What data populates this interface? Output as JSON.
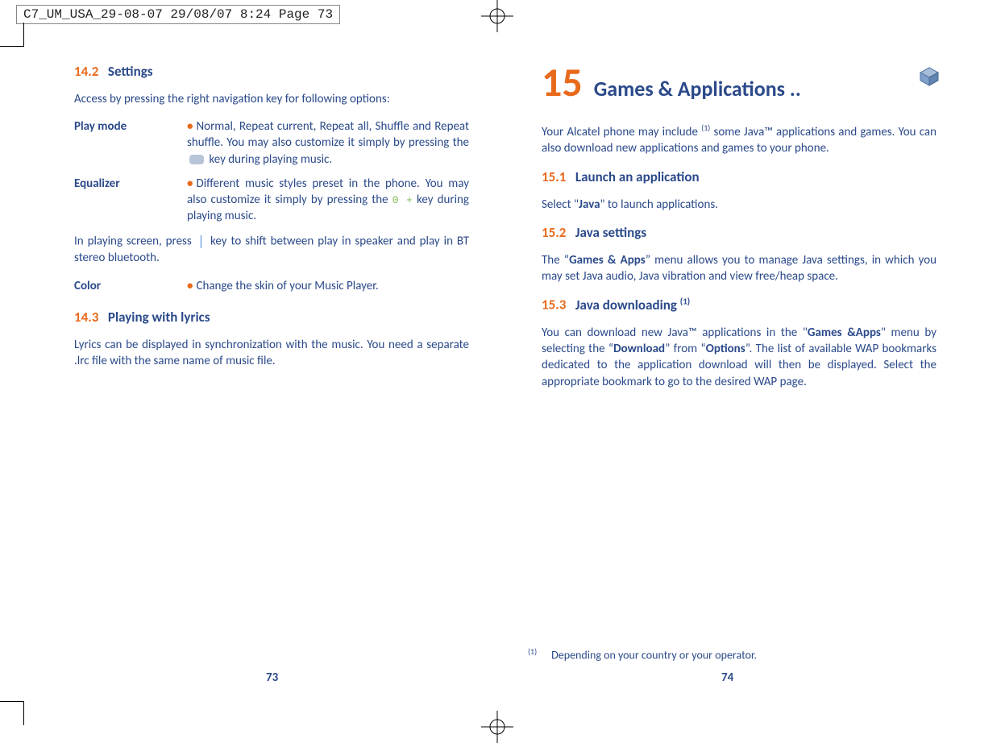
{
  "header": "C7_UM_USA_29-08-07  29/08/07  8:24  Page 73",
  "left": {
    "s142_num": "14.2",
    "s142_title": "Settings",
    "s142_intro": "Access by pressing the right navigation key for following options:",
    "playmode_term": "Play mode",
    "playmode_def_a": "Normal, Repeat current, Repeat all, Shuffle and Repeat shuffle. You may also customize it simply by pressing the ",
    "playmode_def_b": " key during playing music.",
    "eq_term": "Equalizer",
    "eq_def_a": "Different music styles preset in the phone. You may also customize it simply by pressing the ",
    "eq_zerokey": "0 +",
    "eq_def_b": " key during playing music.",
    "bt_a": "In playing screen, press ",
    "bt_icon": "❘",
    "bt_b": " key to shift between play in speaker and play in BT stereo bluetooth.",
    "color_term": "Color",
    "color_def": "Change the skin of your Music Player.",
    "s143_num": "14.3",
    "s143_title": "Playing with lyrics",
    "s143_body": "Lyrics can be displayed in synchronization with the music. You need a separate .lrc file with the same name of music file.",
    "pagenum": "73"
  },
  "right": {
    "chapnum": "15",
    "chaptitle": "Games & Applications ..",
    "intro_a": "Your Alcatel phone may include ",
    "intro_sup": "(1)",
    "intro_b": " some Java™ applications and games. You can also download new applications and games to your phone.",
    "s151_num": "15.1",
    "s151_title": "Launch an application",
    "s151_body_a": "Select \"",
    "s151_java": "Java",
    "s151_body_b": "\" to launch applications.",
    "s152_num": "15.2",
    "s152_title": "Java settings",
    "s152_body_a": "The “",
    "s152_ga": "Games & Apps",
    "s152_body_b": "” menu allows you to manage Java settings, in which you may set Java audio, Java vibration and view free/heap space.",
    "s153_num": "15.3",
    "s153_title_a": "Java downloading ",
    "s153_sup": "(1)",
    "s153_body_a": "You can download new Java™ applications in the \"",
    "s153_ga": "Games &Apps",
    "s153_body_b": "\" menu by selecting the “",
    "s153_dl": "Download",
    "s153_body_c": "” from “",
    "s153_opt": "Options",
    "s153_body_d": "”. The list of available WAP bookmarks dedicated to the application download will then be displayed. Select the appropriate bookmark to go to the desired WAP page.",
    "fn_sup": "(1)",
    "fn_text": "Depending on your country or your operator.",
    "pagenum": "74"
  }
}
